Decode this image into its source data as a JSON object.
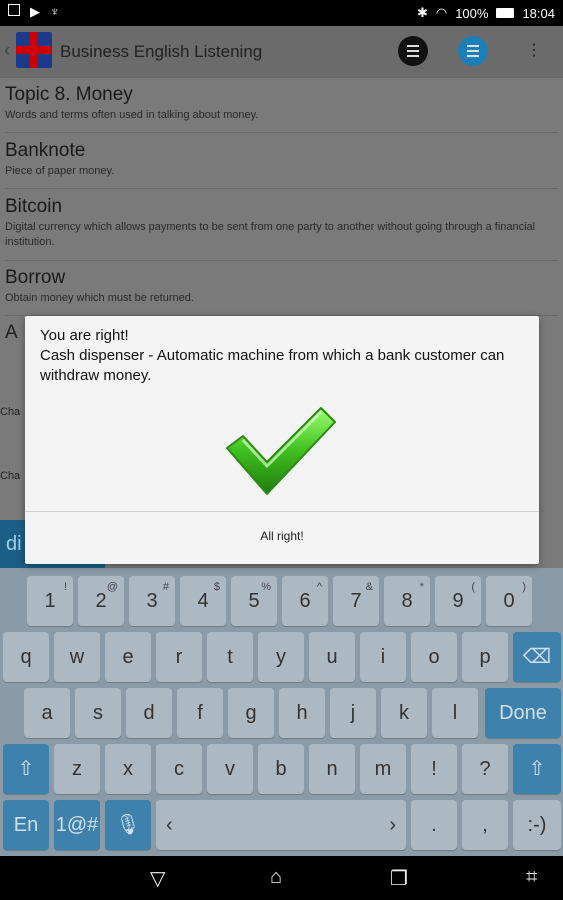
{
  "status_bar": {
    "battery": "100%",
    "time": "18:04"
  },
  "app_bar": {
    "title": "Business English Listening",
    "more": "⋮"
  },
  "list": [
    {
      "title": "Topic 8. Money",
      "desc": "Words and terms often used in talking about money."
    },
    {
      "title": "Banknote",
      "desc": "Piece of paper money."
    },
    {
      "title": "Bitcoin",
      "desc": "Digital currency which allows payments to be sent from one party to another without going through a financial institution."
    },
    {
      "title": "Borrow",
      "desc": "Obtain money which must be returned."
    }
  ],
  "partial": {
    "a": "A",
    "cha1": "Cha",
    "cha2": "Cha",
    "di": "di"
  },
  "dialog": {
    "line1": "You are right!",
    "line2": "Cash dispenser - Automatic machine from which a bank customer can withdraw money.",
    "button": "All right!"
  },
  "keyboard": {
    "row1": [
      {
        "k": "1",
        "s": "!"
      },
      {
        "k": "2",
        "s": "@"
      },
      {
        "k": "3",
        "s": "#"
      },
      {
        "k": "4",
        "s": "$"
      },
      {
        "k": "5",
        "s": "%"
      },
      {
        "k": "6",
        "s": "^"
      },
      {
        "k": "7",
        "s": "&"
      },
      {
        "k": "8",
        "s": "*"
      },
      {
        "k": "9",
        "s": "("
      },
      {
        "k": "0",
        "s": ")"
      }
    ],
    "row2": [
      "q",
      "w",
      "e",
      "r",
      "t",
      "y",
      "u",
      "i",
      "o",
      "p"
    ],
    "row3": [
      "a",
      "s",
      "d",
      "f",
      "g",
      "h",
      "j",
      "k",
      "l"
    ],
    "row4": [
      "z",
      "x",
      "c",
      "v",
      "b",
      "n",
      "m",
      "!",
      "?"
    ],
    "done": "Done",
    "lang": "En",
    "sym": "1@#",
    "dot": ".",
    "comma": ",",
    "smiley": ":-)"
  },
  "colors": {
    "accent": "#3e81ac",
    "check": "#3fbf1f"
  }
}
